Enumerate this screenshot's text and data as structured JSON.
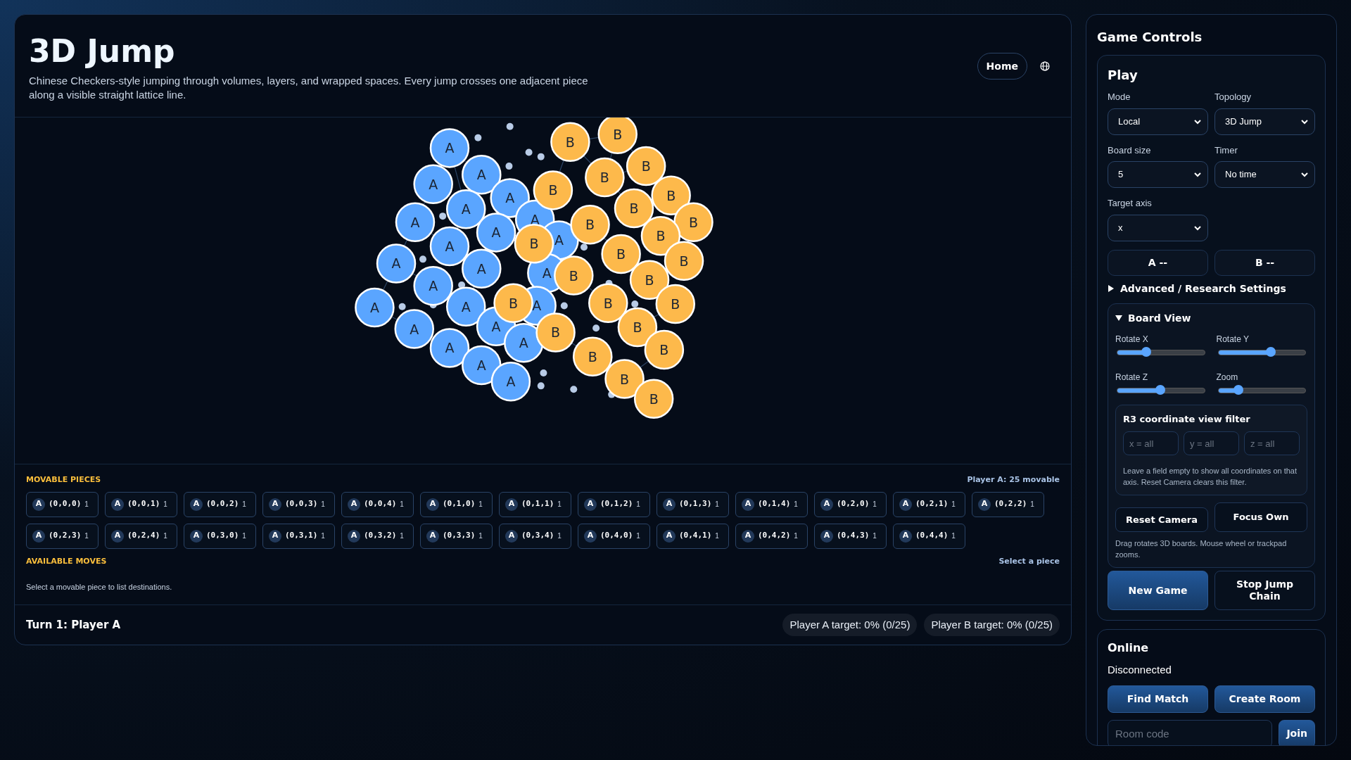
{
  "header": {
    "title": "3D Jump",
    "description": "Chinese Checkers-style jumping through volumes, layers, and wrapped spaces. Every jump crosses one adjacent piece along a visible straight lattice line.",
    "home_button": "Home"
  },
  "board": {
    "pieces": [
      {
        "label": "A",
        "kind": "a"
      },
      {
        "label": "A",
        "kind": "a"
      },
      {
        "label": "A",
        "kind": "a"
      },
      {
        "label": "A",
        "kind": "a"
      },
      {
        "label": "A",
        "kind": "a"
      },
      {
        "label": "A",
        "kind": "a"
      },
      {
        "label": "A",
        "kind": "a"
      },
      {
        "label": "A",
        "kind": "a"
      },
      {
        "label": "A",
        "kind": "a"
      },
      {
        "label": "A",
        "kind": "a"
      },
      {
        "label": "A",
        "kind": "a"
      },
      {
        "label": "A",
        "kind": "a"
      },
      {
        "label": "A",
        "kind": "a"
      },
      {
        "label": "A",
        "kind": "a"
      },
      {
        "label": "A",
        "kind": "a"
      },
      {
        "label": "A",
        "kind": "a"
      },
      {
        "label": "A",
        "kind": "a"
      },
      {
        "label": "A",
        "kind": "a"
      },
      {
        "label": "A",
        "kind": "a"
      },
      {
        "label": "A",
        "kind": "a"
      },
      {
        "label": "A",
        "kind": "a"
      },
      {
        "label": "A",
        "kind": "a"
      },
      {
        "label": "A",
        "kind": "a"
      },
      {
        "label": "B",
        "kind": "b"
      },
      {
        "label": "B",
        "kind": "b"
      },
      {
        "label": "B",
        "kind": "b"
      },
      {
        "label": "B",
        "kind": "b"
      },
      {
        "label": "B",
        "kind": "b"
      },
      {
        "label": "B",
        "kind": "b"
      },
      {
        "label": "B",
        "kind": "b"
      },
      {
        "label": "B",
        "kind": "b"
      },
      {
        "label": "B",
        "kind": "b"
      },
      {
        "label": "B",
        "kind": "b"
      },
      {
        "label": "B",
        "kind": "b"
      },
      {
        "label": "B",
        "kind": "b"
      },
      {
        "label": "B",
        "kind": "b"
      },
      {
        "label": "B",
        "kind": "b"
      },
      {
        "label": "B",
        "kind": "b"
      },
      {
        "label": "B",
        "kind": "b"
      },
      {
        "label": "B",
        "kind": "b"
      },
      {
        "label": "B",
        "kind": "b"
      },
      {
        "label": "B",
        "kind": "b"
      },
      {
        "label": "B",
        "kind": "b"
      },
      {
        "label": "B",
        "kind": "b"
      },
      {
        "label": "B",
        "kind": "b"
      },
      {
        "label": "B",
        "kind": "b"
      },
      {
        "label": "B",
        "kind": "b"
      }
    ]
  },
  "movable": {
    "heading": "MOVABLE PIECES",
    "summary": "Player A: 25 movable",
    "pieces": [
      {
        "player": "A",
        "coord": "(0,0,0)",
        "count": "1"
      },
      {
        "player": "A",
        "coord": "(0,0,1)",
        "count": "1"
      },
      {
        "player": "A",
        "coord": "(0,0,2)",
        "count": "1"
      },
      {
        "player": "A",
        "coord": "(0,0,3)",
        "count": "1"
      },
      {
        "player": "A",
        "coord": "(0,0,4)",
        "count": "1"
      },
      {
        "player": "A",
        "coord": "(0,1,0)",
        "count": "1"
      },
      {
        "player": "A",
        "coord": "(0,1,1)",
        "count": "1"
      },
      {
        "player": "A",
        "coord": "(0,1,2)",
        "count": "1"
      },
      {
        "player": "A",
        "coord": "(0,1,3)",
        "count": "1"
      },
      {
        "player": "A",
        "coord": "(0,1,4)",
        "count": "1"
      },
      {
        "player": "A",
        "coord": "(0,2,0)",
        "count": "1"
      },
      {
        "player": "A",
        "coord": "(0,2,1)",
        "count": "1"
      },
      {
        "player": "A",
        "coord": "(0,2,2)",
        "count": "1"
      },
      {
        "player": "A",
        "coord": "(0,2,3)",
        "count": "1"
      },
      {
        "player": "A",
        "coord": "(0,2,4)",
        "count": "1"
      },
      {
        "player": "A",
        "coord": "(0,3,0)",
        "count": "1"
      },
      {
        "player": "A",
        "coord": "(0,3,1)",
        "count": "1"
      },
      {
        "player": "A",
        "coord": "(0,3,2)",
        "count": "1"
      },
      {
        "player": "A",
        "coord": "(0,3,3)",
        "count": "1"
      },
      {
        "player": "A",
        "coord": "(0,3,4)",
        "count": "1"
      },
      {
        "player": "A",
        "coord": "(0,4,0)",
        "count": "1"
      },
      {
        "player": "A",
        "coord": "(0,4,1)",
        "count": "1"
      },
      {
        "player": "A",
        "coord": "(0,4,2)",
        "count": "1"
      },
      {
        "player": "A",
        "coord": "(0,4,3)",
        "count": "1"
      },
      {
        "player": "A",
        "coord": "(0,4,4)",
        "count": "1"
      }
    ]
  },
  "moves": {
    "heading": "AVAILABLE MOVES",
    "status": "Select a piece",
    "hint": "Select a movable piece to list destinations."
  },
  "footer": {
    "turn": "Turn 1: Player A",
    "targets": [
      "Player A target: 0% (0/25)",
      "Player B target: 0% (0/25)"
    ]
  },
  "controls": {
    "title": "Game Controls",
    "play": {
      "title": "Play",
      "selects": [
        {
          "label": "Mode",
          "value": "Local"
        },
        {
          "label": "Topology",
          "value": "3D Jump"
        },
        {
          "label": "Board size",
          "value": "5"
        },
        {
          "label": "Timer",
          "value": "No time"
        },
        {
          "label": "Target axis",
          "value": "x"
        }
      ],
      "scores": [
        "A --",
        "B --"
      ],
      "advanced": {
        "label": "Advanced / Research Settings",
        "expanded": false
      },
      "board_view": {
        "label": "Board View",
        "expanded": true,
        "sliders": [
          {
            "label": "Rotate X",
            "level": 0.33
          },
          {
            "label": "Rotate Y",
            "level": 0.6
          },
          {
            "label": "Rotate Z",
            "level": 0.49
          },
          {
            "label": "Zoom",
            "level": 0.23
          }
        ],
        "filter": {
          "title": "R3 coordinate view filter",
          "fields": [
            {
              "placeholder": "x = all"
            },
            {
              "placeholder": "y = all"
            },
            {
              "placeholder": "z = all"
            }
          ],
          "note": "Leave a field empty to show all coordinates on that axis. Reset Camera clears this filter."
        },
        "buttons": [
          "Reset Camera",
          "Focus Own"
        ],
        "hint": "Drag rotates 3D boards. Mouse wheel or trackpad zooms."
      },
      "actions": [
        {
          "label": "New Game",
          "kind": "primary"
        },
        {
          "label": "Stop Jump Chain",
          "kind": "secondary"
        }
      ]
    },
    "online": {
      "title": "Online",
      "status": "Disconnected",
      "buttons": [
        "Find Match",
        "Create Room"
      ],
      "room": {
        "placeholder": "Room code"
      },
      "join": "Join"
    }
  }
}
